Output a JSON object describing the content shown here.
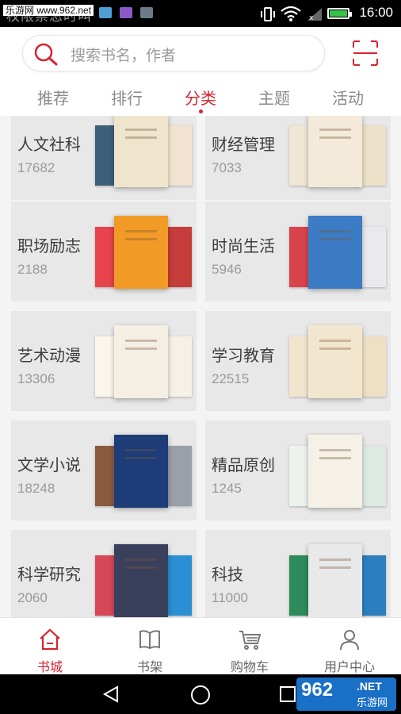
{
  "status_bar": {
    "watermark": "乐游网 www.962.net",
    "app_title": "权限禁忌时叫",
    "time": "16:00"
  },
  "search": {
    "placeholder": "搜索书名，作者"
  },
  "tabs": [
    {
      "label": "推荐",
      "active": false
    },
    {
      "label": "排行",
      "active": false
    },
    {
      "label": "分类",
      "active": true
    },
    {
      "label": "主题",
      "active": false
    },
    {
      "label": "活动",
      "active": false
    }
  ],
  "categories": [
    {
      "name": "人文社科",
      "count": "17682",
      "covers": [
        "#3c5f7a",
        "#efe4cc",
        "#f1e3cf"
      ]
    },
    {
      "name": "财经管理",
      "count": "7033",
      "covers": [
        "#efe6d3",
        "#f4ead9",
        "#ece0c8"
      ]
    },
    {
      "name": "职场励志",
      "count": "2188",
      "covers": [
        "#e7434c",
        "#f29a26",
        "#c63c3a"
      ]
    },
    {
      "name": "时尚生活",
      "count": "5946",
      "covers": [
        "#d8434c",
        "#3b7cc4",
        "#e9e9ee"
      ]
    },
    {
      "name": "艺术动漫",
      "count": "13306",
      "covers": [
        "#faf6ee",
        "#f5efe3",
        "#f6f1e7"
      ]
    },
    {
      "name": "学习教育",
      "count": "22515",
      "covers": [
        "#f1e5ce",
        "#f3e6cf",
        "#efe0c4"
      ]
    },
    {
      "name": "文学小说",
      "count": "18248",
      "covers": [
        "#8b5a3c",
        "#1d3c78",
        "#9aa0a8"
      ]
    },
    {
      "name": "精品原创",
      "count": "1245",
      "covers": [
        "#eef2ee",
        "#f5f1e6",
        "#dfe9e3"
      ]
    },
    {
      "name": "科学研究",
      "count": "2060",
      "covers": [
        "#d8465a",
        "#3a3f5c",
        "#2b8fd4"
      ]
    },
    {
      "name": "科技",
      "count": "11000",
      "covers": [
        "#2d8c5a",
        "#e9e9e9",
        "#2c7fbf"
      ]
    }
  ],
  "bottom_nav": [
    {
      "label": "书城",
      "icon": "home-icon",
      "active": true
    },
    {
      "label": "书架",
      "icon": "bookshelf-icon",
      "active": false
    },
    {
      "label": "购物车",
      "icon": "cart-icon",
      "active": false
    },
    {
      "label": "用户中心",
      "icon": "user-icon",
      "active": false
    }
  ],
  "watermark_bottom": {
    "big": "962",
    "net": ".NET",
    "cn": "乐游网"
  },
  "colors": {
    "accent": "#d6242f",
    "card_bg": "#e8e8e8",
    "status_bg": "#000000"
  }
}
